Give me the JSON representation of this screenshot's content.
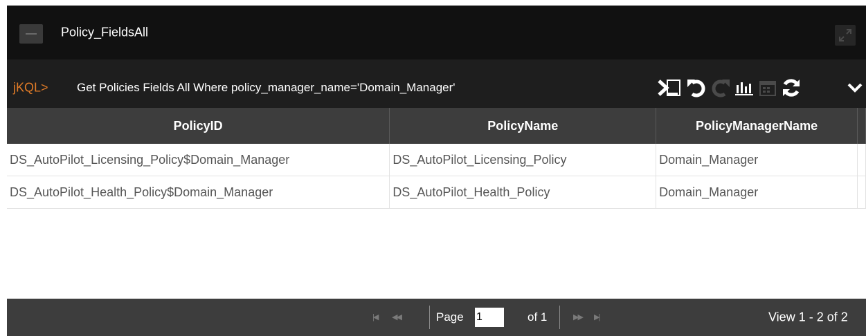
{
  "window": {
    "title": "Policy_FieldsAll",
    "collapse_icon": "minus-icon",
    "maximize_icon": "expand-icon"
  },
  "query": {
    "prompt": "jKQL>",
    "text": "Get Policies Fields All Where policy_manager_name='Domain_Manager'"
  },
  "toolbar": {
    "icons": [
      "terminal-icon",
      "undo-icon",
      "redo-icon",
      "bar-chart-icon",
      "calendar-icon",
      "refresh-icon",
      "chevron-down-icon"
    ]
  },
  "table": {
    "columns": [
      "PolicyID",
      "PolicyName",
      "PolicyManagerName"
    ],
    "rows": [
      [
        "DS_AutoPilot_Licensing_Policy$Domain_Manager",
        "DS_AutoPilot_Licensing_Policy",
        "Domain_Manager"
      ],
      [
        "DS_AutoPilot_Health_Policy$Domain_Manager",
        "DS_AutoPilot_Health_Policy",
        "Domain_Manager"
      ]
    ]
  },
  "pager": {
    "page_label": "Page",
    "page_value": "1",
    "of_label": "of 1",
    "view_text": "View 1 - 2 of 2"
  },
  "colors": {
    "prompt": "#e07b27",
    "header_bg": "#3d3d3d",
    "titlebar_bg": "#111111",
    "panel_bg": "#1e1e1e"
  }
}
